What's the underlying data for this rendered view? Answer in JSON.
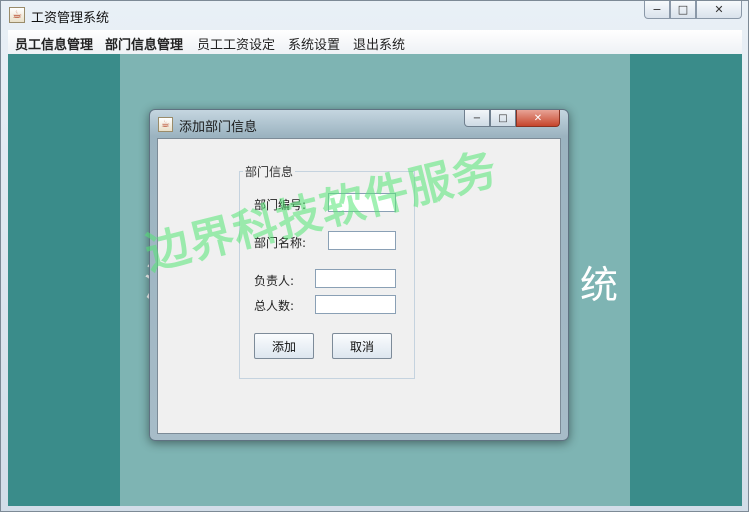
{
  "window": {
    "title": "工资管理系统"
  },
  "window_buttons": {
    "minimize": "−",
    "maximize": "□",
    "close": "✕"
  },
  "menu": [
    {
      "label": "员工信息管理"
    },
    {
      "label": "部门信息管理"
    },
    {
      "label": "员工工资设定"
    },
    {
      "label": "系统设置"
    },
    {
      "label": "退出系统"
    }
  ],
  "background": {
    "glyph_left": "消",
    "glyph_right": "统"
  },
  "dialog": {
    "title": "添加部门信息",
    "group_title": "部门信息",
    "fields": {
      "dept_no_label": "部门编号:",
      "dept_no_value": "",
      "dept_name_label": "部门名称:",
      "dept_name_value": "",
      "manager_label": "负责人:",
      "manager_value": "",
      "headcount_label": "总人数:",
      "headcount_value": ""
    },
    "buttons": {
      "add": "添加",
      "cancel": "取消"
    }
  },
  "watermark": "边界科技软件服务",
  "icons": {
    "app": "java-cup-icon",
    "dialog": "java-cup-icon"
  },
  "colors": {
    "content_bg": "#3a8c8a",
    "center_panel": "#7eb4b3",
    "watermark": "#54e674"
  }
}
